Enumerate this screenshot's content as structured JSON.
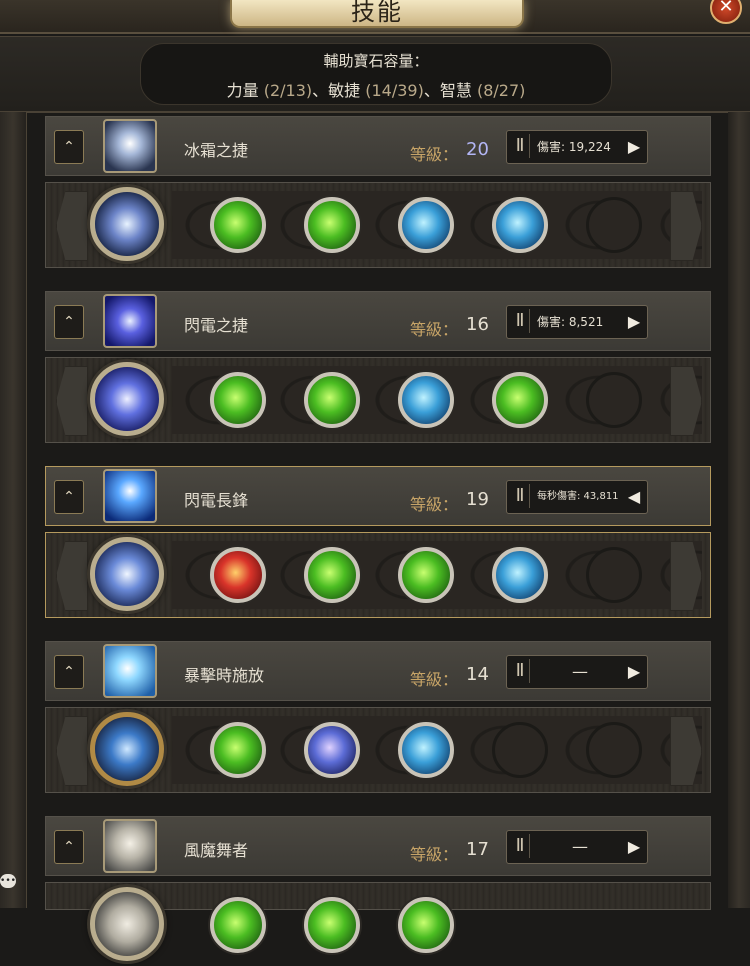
{
  "window": {
    "title": "技能",
    "close_icon": "close-icon"
  },
  "capacity": {
    "title": "輔助寶石容量：",
    "str_label": "力量",
    "str_value": "(2/13)",
    "sep1": "、",
    "dex_label": "敏捷",
    "dex_value": "(14/39)",
    "sep2": "、",
    "int_label": "智慧",
    "int_value": "(8/27)"
  },
  "level_label": "等級：",
  "skills": [
    {
      "name": "冰霜之捷",
      "level": "20",
      "damage": "傷害: 19,224",
      "main_gem": "frost-blink-gem",
      "supports": [
        "green",
        "green",
        "blue",
        "blue"
      ]
    },
    {
      "name": "閃電之捷",
      "level": "16",
      "damage": "傷害: 8,521",
      "main_gem": "lightning-blink-gem",
      "supports": [
        "green",
        "green",
        "blue",
        "green"
      ]
    },
    {
      "name": "閃電長鋒",
      "level": "19",
      "damage": "每秒傷害: 43,811",
      "main_gem": "lightning-spear-gem",
      "supports": [
        "red",
        "green",
        "green",
        "blue"
      ]
    },
    {
      "name": "暴擊時施放",
      "level": "14",
      "damage": "—",
      "main_gem": "cast-on-crit-gem",
      "supports": [
        "green",
        "purple",
        "blue"
      ]
    },
    {
      "name": "風魔舞者",
      "level": "17",
      "damage": "—",
      "main_gem": "wind-dancer-gem",
      "supports": [
        "green",
        "green",
        "green"
      ]
    }
  ]
}
